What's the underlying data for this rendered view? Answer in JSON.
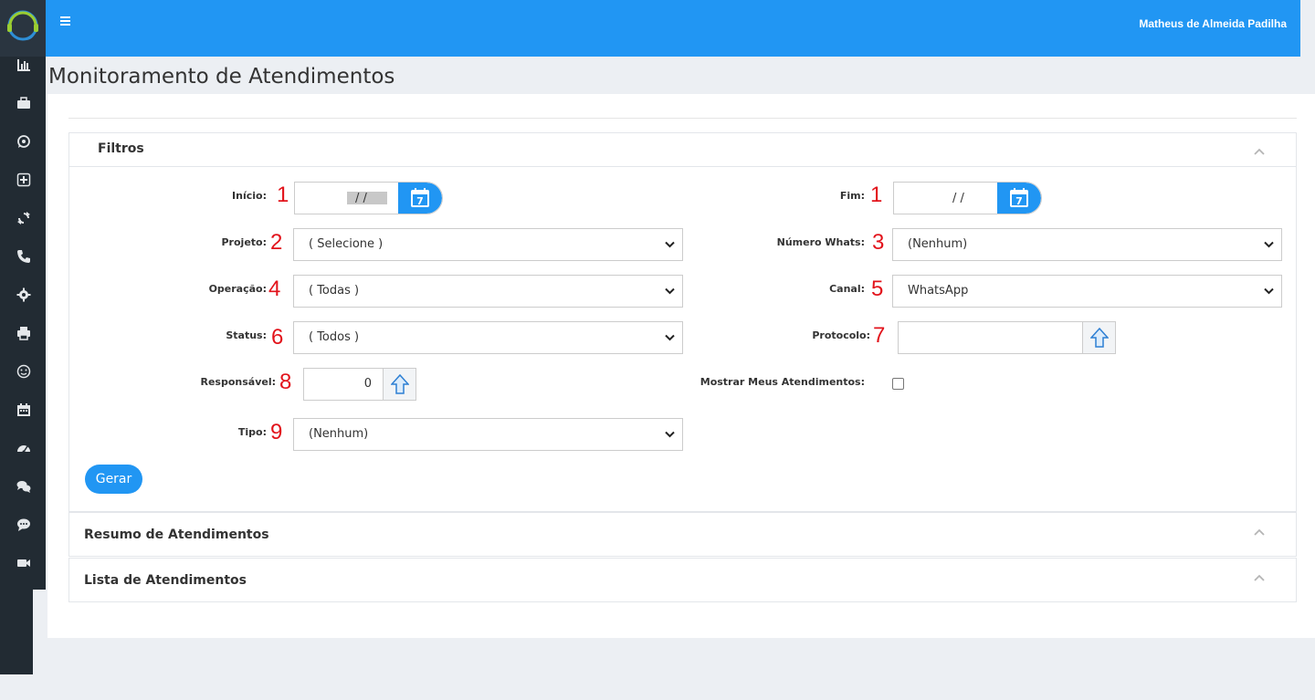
{
  "header": {
    "user_name": "Matheus de Almeida Padilha"
  },
  "page": {
    "title": "Monitoramento de Atendimentos"
  },
  "sidebar": {
    "items": [
      {
        "icon": "bar-chart-icon"
      },
      {
        "icon": "briefcase-icon"
      },
      {
        "icon": "whatsapp-icon"
      },
      {
        "icon": "plus-square-icon"
      },
      {
        "icon": "refresh-icon"
      },
      {
        "icon": "phone-icon"
      },
      {
        "icon": "gear-icon"
      },
      {
        "icon": "printer-icon"
      },
      {
        "icon": "smile-icon"
      },
      {
        "icon": "calendar-icon"
      },
      {
        "icon": "dashboard-icon"
      },
      {
        "icon": "chat-bubbles-icon"
      },
      {
        "icon": "comment-icon"
      },
      {
        "icon": "video-camera-icon"
      }
    ]
  },
  "filters": {
    "title": "Filtros",
    "inicio": {
      "label": "Início:",
      "marker": "1",
      "value": "/ /"
    },
    "fim": {
      "label": "Fim:",
      "marker": "1",
      "value": "/ /"
    },
    "calendar_day": "7",
    "projeto": {
      "label": "Projeto:",
      "marker": "2",
      "value": "( Selecione )"
    },
    "numero_whats": {
      "label": "Número Whats:",
      "marker": "3",
      "value": "(Nenhum)"
    },
    "operacao": {
      "label": "Operação:",
      "marker": "4",
      "value": "( Todas )"
    },
    "canal": {
      "label": "Canal:",
      "marker": "5",
      "value": "WhatsApp"
    },
    "status": {
      "label": "Status:",
      "marker": "6",
      "value": "( Todos )"
    },
    "protocolo": {
      "label": "Protocolo:",
      "marker": "7",
      "value": ""
    },
    "responsavel": {
      "label": "Responsável:",
      "marker": "8",
      "value": "0"
    },
    "mostrar_meus": {
      "label": "Mostrar Meus Atendimentos:",
      "checked": false
    },
    "tipo": {
      "label": "Tipo:",
      "marker": "9",
      "value": "(Nenhum)"
    },
    "submit_label": "Gerar"
  },
  "panels": {
    "resumo_title": "Resumo de Atendimentos",
    "lista_title": "Lista de Atendimentos"
  },
  "colors": {
    "primary": "#2196f3",
    "sidebar": "#222b33",
    "marker": "#e2131b"
  }
}
